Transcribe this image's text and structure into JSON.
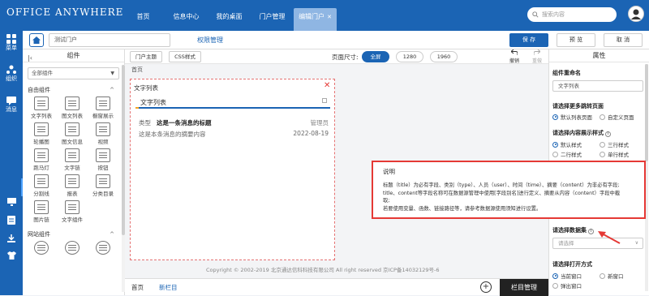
{
  "header": {
    "logo": "OFFICE ANYWHERE",
    "tabs": [
      "首页",
      "信息中心",
      "我的桌面",
      "门户管理",
      "编辑门户"
    ],
    "active_tab_index": 4,
    "search_placeholder": "搜索内容"
  },
  "rail": {
    "items": [
      {
        "label": "菜单",
        "icon": "grid-icon"
      },
      {
        "label": "组织",
        "icon": "org-icon"
      },
      {
        "label": "消息",
        "icon": "message-icon"
      }
    ]
  },
  "toolbar": {
    "portal_name": "测试门户",
    "permission_label": "权限管理",
    "save_label": "保 存",
    "preview_label": "预 览",
    "cancel_label": "取 消"
  },
  "components": {
    "title": "组件",
    "select_value": "全部组件",
    "group1": "自由组件",
    "items": [
      "文字列表",
      "图文列表",
      "橱窗展示",
      "轮播图",
      "图文信息",
      "视频",
      "跑马灯",
      "文字链",
      "按钮",
      "分割线",
      "报表",
      "分类目录",
      "图片链",
      "文字组件"
    ],
    "group2": "网站组件"
  },
  "canvas": {
    "theme_btn": "门户主题",
    "css_btn": "CSS样式",
    "size_label": "页面尺寸:",
    "sizes": [
      "全屏",
      "1280",
      "1960"
    ],
    "undo": "撤销",
    "redo": "重做",
    "home_label": "首页",
    "widget": {
      "name": "文字列表",
      "tab": "文字列表",
      "type_label": "类型",
      "news_title": "这是一条消息的标题",
      "user": "管理员",
      "summary": "这是本条消息的摘要内容",
      "date": "2022-08-19"
    },
    "copyright": "Copyright © 2002-2019 北京通达信科科技有限公司 All right reserved 京ICP备14032129号-6",
    "bottom_tabs": [
      "首页",
      "新栏目"
    ],
    "column_manage": "栏目管理"
  },
  "props": {
    "title": "属性",
    "rename_label": "组件重命名",
    "rename_value": "文字列表",
    "more_jump_label": "请选择更多跳转页面",
    "more_jump_options": [
      "默认列表页面",
      "自定义页面"
    ],
    "display_style_label": "请选择内容展示样式",
    "display_style_options": [
      "默认样式",
      "三行样式",
      "二行样式",
      "单行样式"
    ],
    "dataset_label": "请选择数据集",
    "dataset_placeholder": "请选择",
    "open_mode_label": "请选择打开方式",
    "open_mode_options": [
      "当前窗口",
      "新窗口",
      "弹出窗口"
    ]
  },
  "callout": {
    "title": "说明",
    "lines": [
      "标题（title）为必有字段、类别（type）、人员（user）、时间（time）、摘要（content）为非必有字段;",
      "title、content等字段名称可在数据源管理中使用[字段别名]进行定义、摘要从内容（content）字段中截",
      "取;",
      "若要使用变量、函数、链接路径等，请参考数据源使用须知进行设置。"
    ]
  },
  "colors": {
    "brand": "#1b64b4",
    "highlight": "#e53935"
  }
}
